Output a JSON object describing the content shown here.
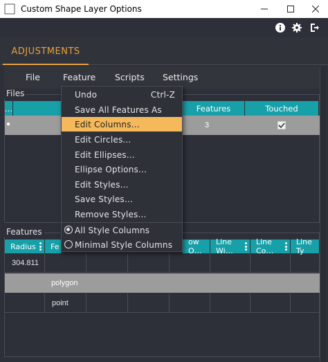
{
  "window": {
    "title": "Custom Shape Layer Options"
  },
  "tabs": {
    "adjustments": "ADJUSTMENTS"
  },
  "menubar": {
    "file": "File",
    "feature": "Feature",
    "scripts": "Scripts",
    "settings": "Settings"
  },
  "files_panel": {
    "label": "Files",
    "columns": [
      "…",
      "Features",
      "Touched"
    ],
    "row": {
      "features": "3",
      "touched": true
    }
  },
  "features_panel": {
    "label": "Features",
    "columns": [
      "Radius",
      "Fe",
      "ow O…",
      "Line Wi…",
      "Line Co…",
      "Line Ty"
    ],
    "rows": [
      {
        "radius": "304.811",
        "feature": ""
      },
      {
        "radius": "",
        "feature": "polygon"
      },
      {
        "radius": "",
        "feature": "point"
      }
    ]
  },
  "feature_menu": {
    "items": [
      {
        "label": "Undo",
        "shortcut": "Ctrl-Z"
      },
      {
        "label": "Save All Features As",
        "shortcut": ""
      },
      {
        "label": "Edit Columns...",
        "shortcut": ""
      },
      {
        "label": "Edit Circles...",
        "shortcut": ""
      },
      {
        "label": "Edit Ellipses...",
        "shortcut": ""
      },
      {
        "label": "Ellipse Options...",
        "shortcut": ""
      },
      {
        "label": "Edit Styles...",
        "shortcut": ""
      },
      {
        "label": "Save Styles...",
        "shortcut": ""
      },
      {
        "label": "Remove Styles...",
        "shortcut": ""
      }
    ],
    "radio_items": [
      {
        "label": "All Style Columns",
        "checked": true
      },
      {
        "label": "Minimal Style Columns",
        "checked": false
      }
    ],
    "highlighted_index": 2
  },
  "colors": {
    "accent": "#e8a23a",
    "grid_header": "#17a0a8",
    "highlight": "#f5b95c",
    "background": "#2e3039"
  },
  "icons": [
    "app-icon",
    "minimize-icon",
    "maximize-icon",
    "close-icon",
    "info-icon",
    "gear-icon",
    "exit-icon",
    "checkbox-checked-icon",
    "column-menu-icon"
  ]
}
